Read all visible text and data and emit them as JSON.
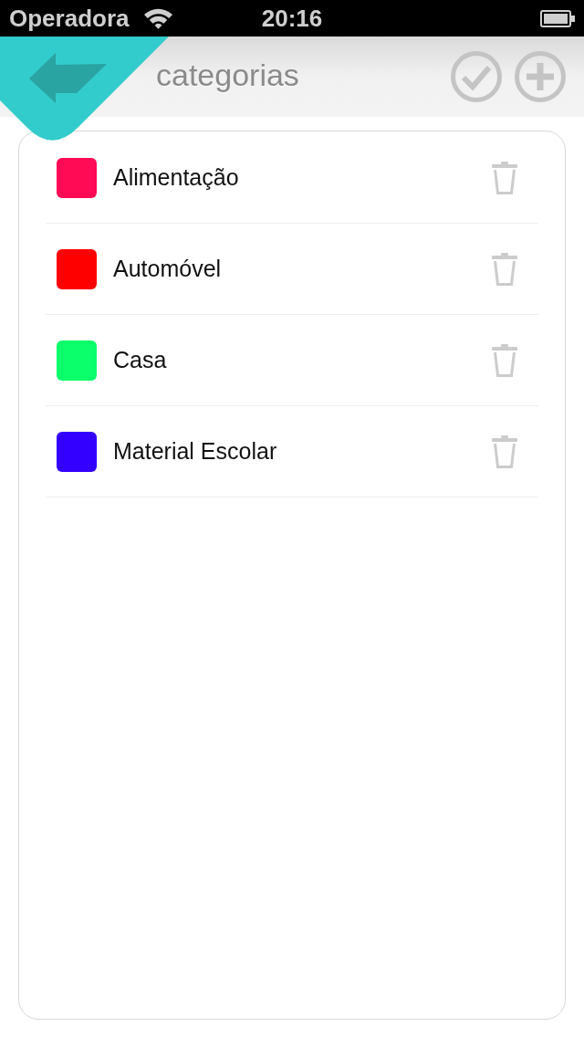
{
  "status_bar": {
    "carrier": "Operadora",
    "time": "20:16"
  },
  "header": {
    "title": "categorias"
  },
  "categories": [
    {
      "name": "Alimentação",
      "color": "#ff0a54"
    },
    {
      "name": "Automóvel",
      "color": "#ff0000"
    },
    {
      "name": "Casa",
      "color": "#0aff6a"
    },
    {
      "name": "Material Escolar",
      "color": "#3300ff"
    }
  ]
}
